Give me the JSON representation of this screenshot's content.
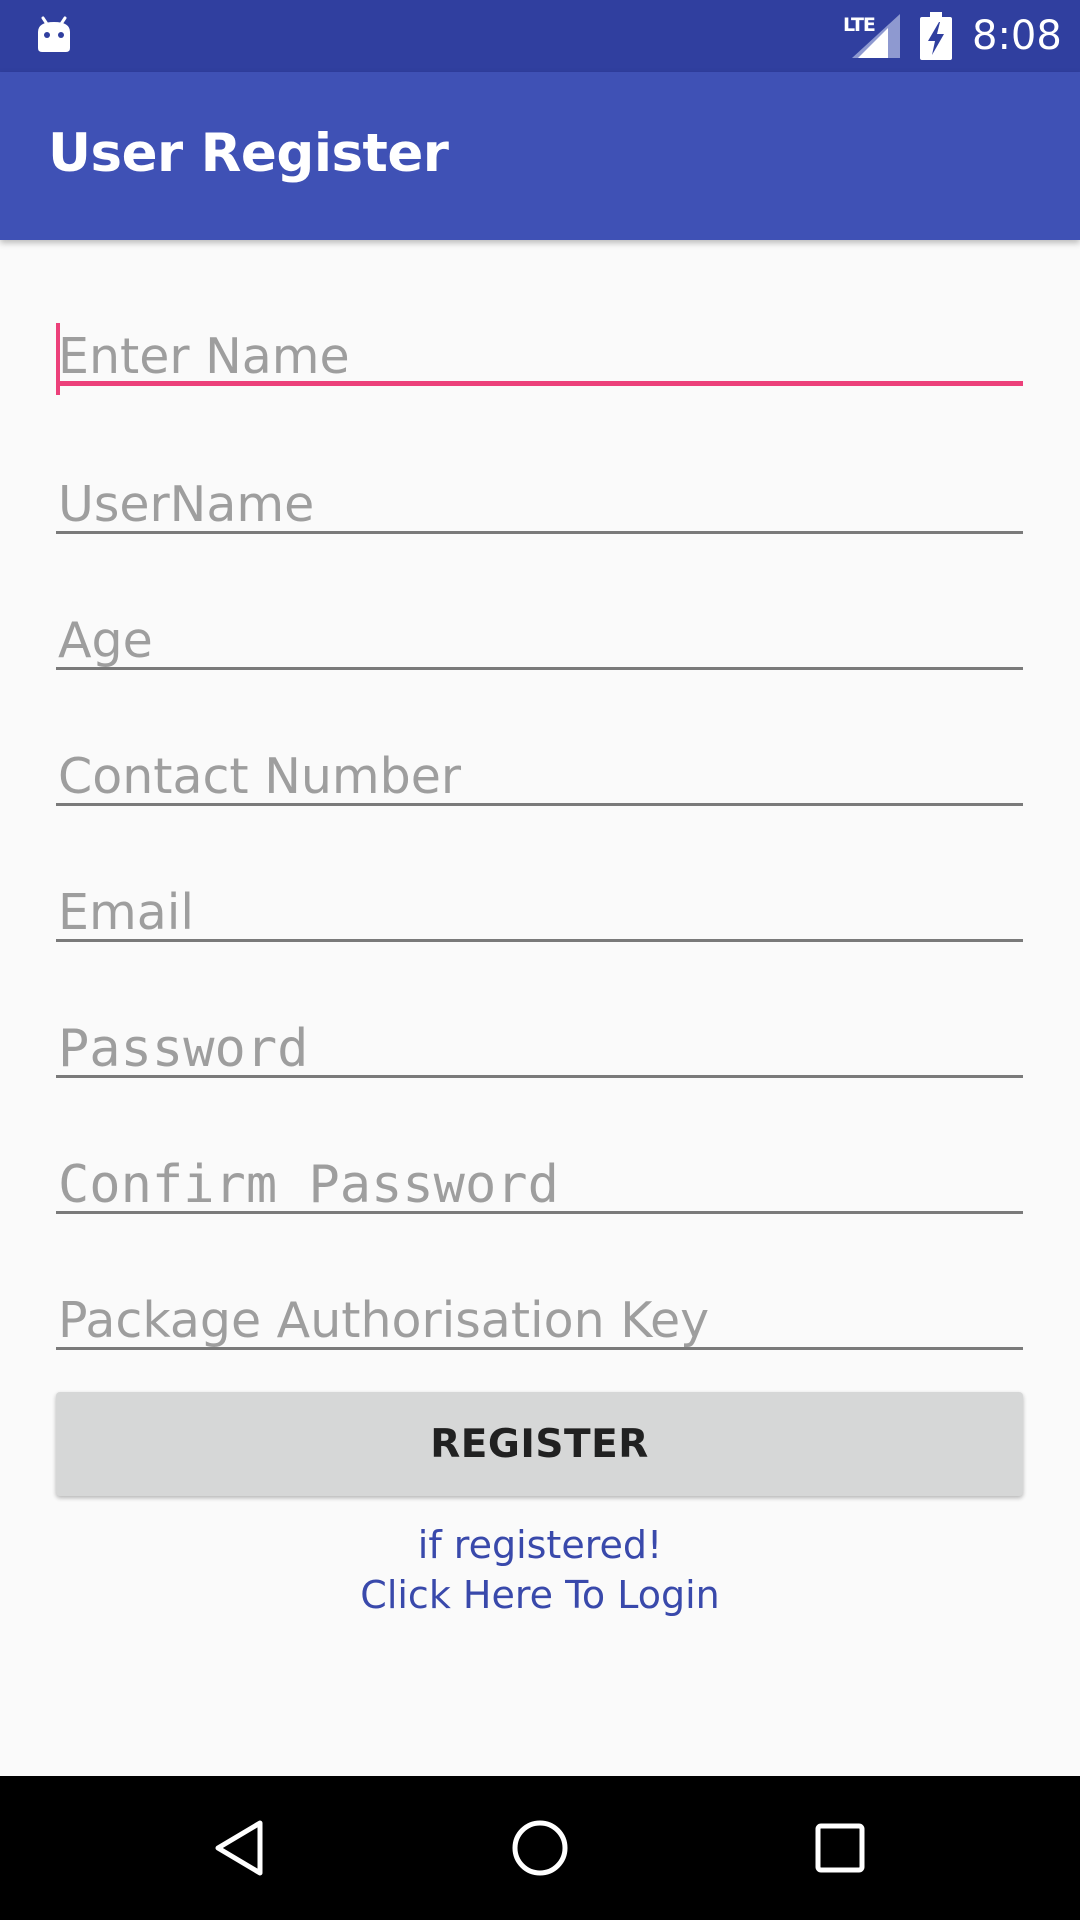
{
  "status_bar": {
    "network": "LTE",
    "time": "8:08",
    "icons": [
      "android-debug-icon",
      "lte-signal-icon",
      "battery-charging-icon"
    ]
  },
  "app_bar": {
    "title": "User Register"
  },
  "form": {
    "fields": [
      {
        "placeholder": "Enter Name",
        "value": "",
        "focused": true
      },
      {
        "placeholder": "UserName",
        "value": ""
      },
      {
        "placeholder": "Age",
        "value": ""
      },
      {
        "placeholder": "Contact Number",
        "value": ""
      },
      {
        "placeholder": "Email",
        "value": ""
      },
      {
        "placeholder": "Password",
        "value": "",
        "type": "password"
      },
      {
        "placeholder": "Confirm Password",
        "value": "",
        "type": "password"
      },
      {
        "placeholder": "Package Authorisation Key",
        "value": ""
      }
    ],
    "register_label": "REGISTER",
    "login_line1": "if registered!",
    "login_line2": "Click Here To Login"
  },
  "nav_bar": {
    "icons": [
      "back-icon",
      "home-icon",
      "recents-icon"
    ]
  },
  "colors": {
    "status_bar": "#303f9f",
    "app_bar": "#3f51b5",
    "accent": "#ec407a",
    "link": "#3949ab",
    "button": "#d6d7d7"
  }
}
